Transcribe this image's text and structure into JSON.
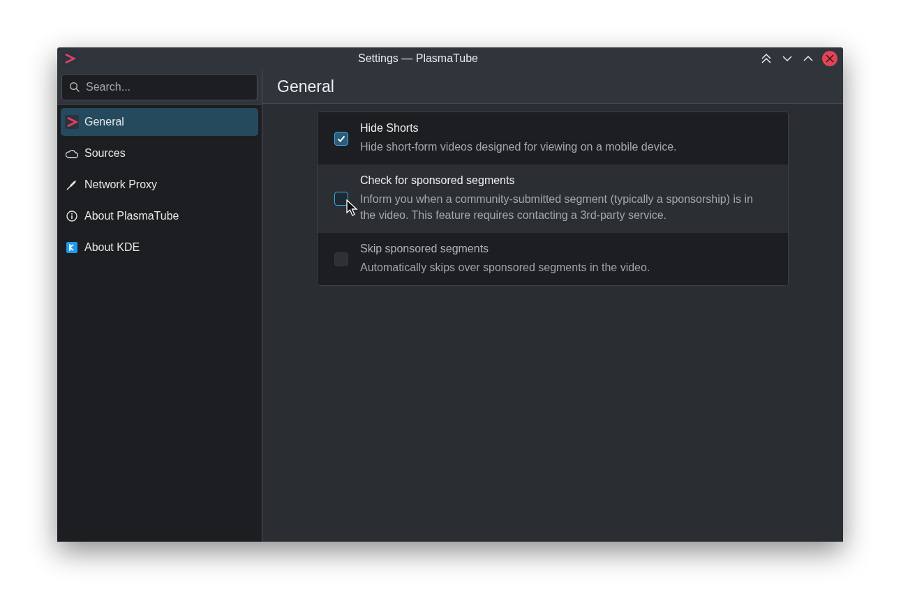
{
  "window": {
    "title": "Settings — PlasmaTube"
  },
  "search": {
    "placeholder": "Search..."
  },
  "page_title": "General",
  "sidebar": {
    "items": [
      {
        "label": "General",
        "kind": "app",
        "selected": true
      },
      {
        "label": "Sources",
        "kind": "cloud",
        "selected": false
      },
      {
        "label": "Network Proxy",
        "kind": "plug",
        "selected": false
      },
      {
        "label": "About PlasmaTube",
        "kind": "info",
        "selected": false
      },
      {
        "label": "About KDE",
        "kind": "kde",
        "selected": false
      }
    ]
  },
  "options": [
    {
      "title": "Hide Shorts",
      "description": "Hide short-form videos designed for viewing on a mobile device.",
      "checked": true,
      "hovered": false,
      "disabled": false
    },
    {
      "title": "Check for sponsored segments",
      "description": "Inform you when a community-submitted segment (typically a sponsorship) is in the video. This feature requires contacting a 3rd-party service.",
      "checked": false,
      "hovered": true,
      "disabled": false
    },
    {
      "title": "Skip sponsored segments",
      "description": "Automatically skips over sponsored segments in the video.",
      "checked": false,
      "hovered": false,
      "disabled": true
    }
  ]
}
